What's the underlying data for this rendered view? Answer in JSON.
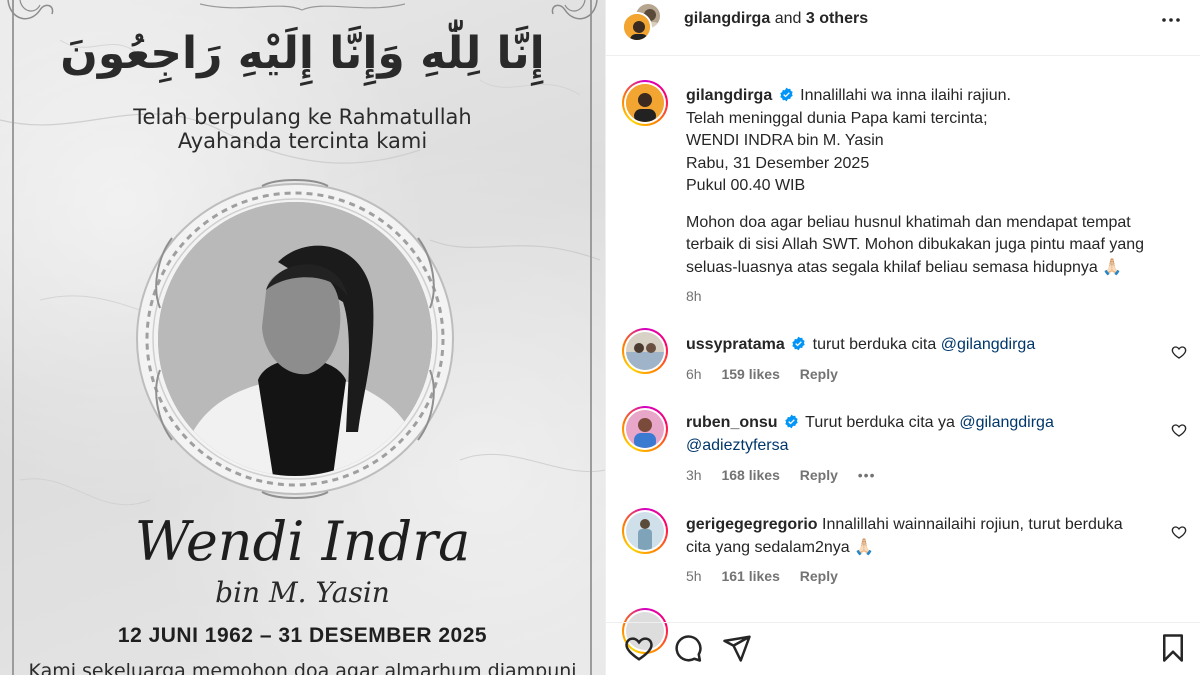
{
  "post_image": {
    "arabic_text": "إِنَّا لِلّٰهِ وَإِنَّا إِلَيْهِ رَاجِعُونَ",
    "intro_line1": "Telah berpulang ke Rahmatullah",
    "intro_line2": "Ayahanda tercinta kami",
    "name": "Wendi Indra",
    "bin": "bin M. Yasin",
    "dates": "12 JUNI 1962 – 31 DESEMBER 2025",
    "closing": "Kami sekeluarga memohon doa agar almarhum diampuni"
  },
  "header": {
    "username": "gilangdirga",
    "connector": "and",
    "others": "3 others",
    "more_icon": "more-horizontal-icon"
  },
  "caption": {
    "username": "gilangdirga",
    "verified": true,
    "line1": "Innalillahi wa inna ilaihi rajiun.",
    "line2": "Telah meninggal dunia Papa kami tercinta;",
    "line3": "WENDI INDRA bin M. Yasin",
    "line4": "Rabu, 31 Desember 2025",
    "line5": "Pukul 00.40 WIB",
    "para2_line1": "Mohon doa agar beliau husnul khatimah dan mendapat tempat",
    "para2_line2": "terbaik di sisi Allah SWT. Mohon dibukakan juga pintu maaf yang",
    "para2_line3": "seluas-luasnya atas segala khilaf beliau semasa hidupnya",
    "emoji": "🙏🏻",
    "time": "8h"
  },
  "comments": [
    {
      "username": "ussypratama",
      "verified": true,
      "text": "turut berduka cita",
      "mention": "@gilangdirga",
      "time": "6h",
      "likes": "159 likes",
      "reply": "Reply"
    },
    {
      "username": "ruben_onsu",
      "verified": true,
      "text": "Turut berduka cita ya",
      "mention": "@gilangdirga",
      "mention2": "@adieztyfersa",
      "time": "3h",
      "likes": "168 likes",
      "reply": "Reply",
      "more": "•••"
    },
    {
      "username": "gerigegegregorio",
      "verified": false,
      "text": "Innalillahi wainnailaihi rojiun, turut berduka",
      "text_line2": "cita yang sedalam2nya",
      "emoji": "🙏🏻",
      "time": "5h",
      "likes": "161 likes",
      "reply": "Reply"
    }
  ],
  "actions": {
    "like_icon": "heart-icon",
    "comment_icon": "comment-icon",
    "share_icon": "share-icon",
    "save_icon": "bookmark-icon"
  },
  "colors": {
    "text": "#262626",
    "secondary": "#737373",
    "link": "#00376b",
    "verified": "#0095f6"
  }
}
